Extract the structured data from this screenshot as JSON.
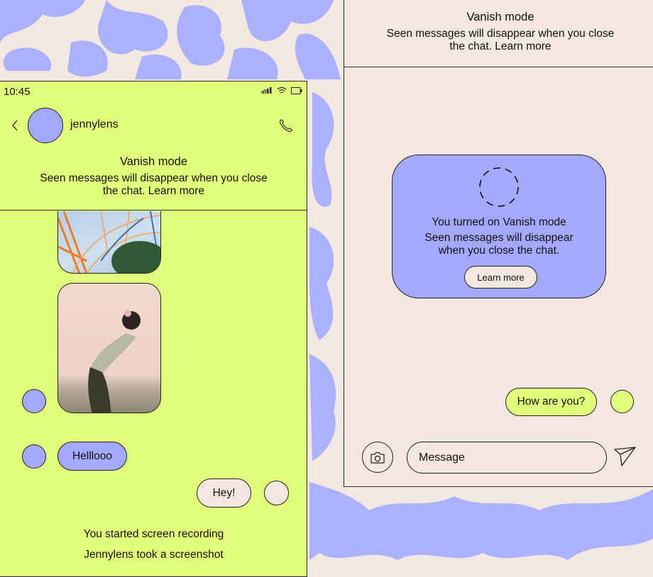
{
  "colors": {
    "lime": "#E2FF7C",
    "periwinkle": "#A4A9FF",
    "beige": "#F3E7DF",
    "ink": "#222222"
  },
  "left_screen": {
    "status_bar": {
      "time": "10:45",
      "icons": [
        "signal-icon",
        "wifi-icon",
        "battery-icon"
      ]
    },
    "header": {
      "back_icon": "chevron-left-icon",
      "username": "jennylens",
      "call_icon": "phone-icon"
    },
    "vanish_banner": {
      "title": "Vanish mode",
      "line1": "Seen messages will disappear when you close",
      "line2": "the chat. Learn more"
    },
    "messages": [
      {
        "type": "image",
        "description": "ferris wheel photo"
      },
      {
        "type": "image",
        "description": "person leaning against wall photo"
      },
      {
        "type": "text",
        "sender": "other",
        "text": "Helllooo"
      },
      {
        "type": "text",
        "sender": "me",
        "text": "Hey!"
      }
    ],
    "system_messages": [
      "You started screen recording",
      "Jennylens took a screenshot"
    ]
  },
  "right_screen": {
    "vanish_banner": {
      "title": "Vanish mode",
      "line1": "Seen messages will disappear when you close",
      "line2": "the chat. Learn more"
    },
    "vanish_card": {
      "icon": "dashed-circle-icon",
      "title": "You turned on Vanish mode",
      "line1": "Seen messages will disappear",
      "line2": "when you close the chat.",
      "button": "Learn more"
    },
    "messages": [
      {
        "type": "text",
        "sender": "me",
        "text": "How are you?"
      }
    ],
    "composer": {
      "camera_icon": "camera-icon",
      "placeholder": "Message",
      "value": "",
      "send_icon": "send-icon"
    }
  }
}
